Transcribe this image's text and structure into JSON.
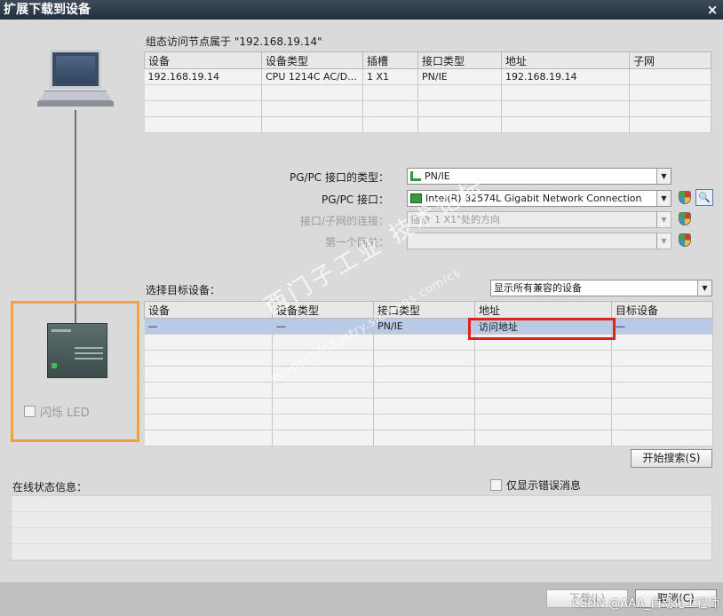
{
  "window": {
    "title": "扩展下载到设备",
    "close_icon": "×"
  },
  "config_node": {
    "label": "组态访问节点属于 \"192.168.19.14\"",
    "columns": [
      "设备",
      "设备类型",
      "插槽",
      "接口类型",
      "地址",
      "子网"
    ],
    "rows": [
      [
        "192.168.19.14",
        "CPU 1214C AC/D...",
        "1 X1",
        "PN/IE",
        "192.168.19.14",
        ""
      ],
      [
        "",
        "",
        "",
        "",
        "",
        ""
      ],
      [
        "",
        "",
        "",
        "",
        "",
        ""
      ],
      [
        "",
        "",
        "",
        "",
        "",
        ""
      ]
    ]
  },
  "interface": {
    "type_label": "PG/PC 接口的类型：",
    "type_value": "PN/IE",
    "iface_label": "PG/PC 接口：",
    "iface_value": "Intel(R) 82574L Gigabit Network Connection",
    "conn_label": "接口/子网的连接：",
    "conn_value": "插槽\"1 X1\"处的方向",
    "gateway_label": "第一个网关：",
    "gateway_value": ""
  },
  "target": {
    "label": "选择目标设备：",
    "filter_value": "显示所有兼容的设备",
    "columns": [
      "设备",
      "设备类型",
      "接口类型",
      "地址",
      "目标设备"
    ],
    "rows": [
      [
        "—",
        "—",
        "PN/IE",
        "访问地址",
        "—"
      ],
      [
        "",
        "",
        "",
        "",
        ""
      ],
      [
        "",
        "",
        "",
        "",
        ""
      ],
      [
        "",
        "",
        "",
        "",
        ""
      ],
      [
        "",
        "",
        "",
        "",
        ""
      ],
      [
        "",
        "",
        "",
        "",
        ""
      ],
      [
        "",
        "",
        "",
        "",
        ""
      ],
      [
        "",
        "",
        "",
        "",
        ""
      ]
    ]
  },
  "device_panel": {
    "flash_led_label": "闪烁 LED"
  },
  "search_button": "开始搜索(S)",
  "status": {
    "label": "在线状态信息：",
    "only_errors_label": "仅显示错误消息"
  },
  "footer": {
    "load_button": "下载(L)",
    "cancel_button": "取消(C)"
  },
  "watermark": {
    "text": "西门子工业 技术论坛",
    "url": "support.industry.siemens.com/cs"
  },
  "overlay": "CSDN @AAA_自动化工程师"
}
